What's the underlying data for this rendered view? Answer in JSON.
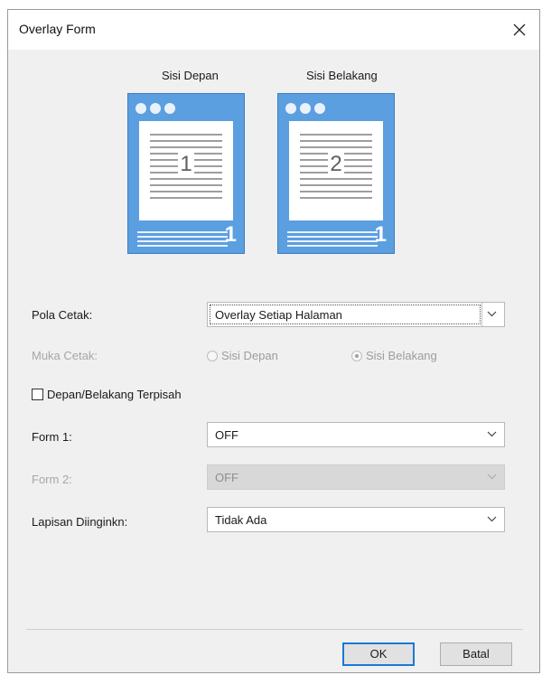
{
  "window": {
    "title": "Overlay Form",
    "close_icon": "close-icon"
  },
  "preview": {
    "front": {
      "label": "Sisi Depan",
      "sheet_number": "1",
      "corner_number": "1"
    },
    "back": {
      "label": "Sisi Belakang",
      "sheet_number": "2",
      "corner_number": "1"
    }
  },
  "form": {
    "pola_cetak": {
      "label": "Pola Cetak:",
      "value": "Overlay Setiap Halaman"
    },
    "muka_cetak": {
      "label": "Muka Cetak:",
      "options": [
        {
          "label": "Sisi Depan",
          "checked": false
        },
        {
          "label": "Sisi Belakang",
          "checked": true
        }
      ]
    },
    "separate": {
      "label": "Depan/Belakang Terpisah",
      "checked": false
    },
    "form1": {
      "label": "Form 1:",
      "value": "OFF"
    },
    "form2": {
      "label": "Form 2:",
      "value": "OFF"
    },
    "layer": {
      "label": "Lapisan Diinginkn:",
      "value": "Tidak Ada"
    }
  },
  "buttons": {
    "ok": "OK",
    "cancel": "Batal"
  },
  "colors": {
    "page_blue": "#5b9fe0",
    "ok_border": "#1a78d6"
  }
}
